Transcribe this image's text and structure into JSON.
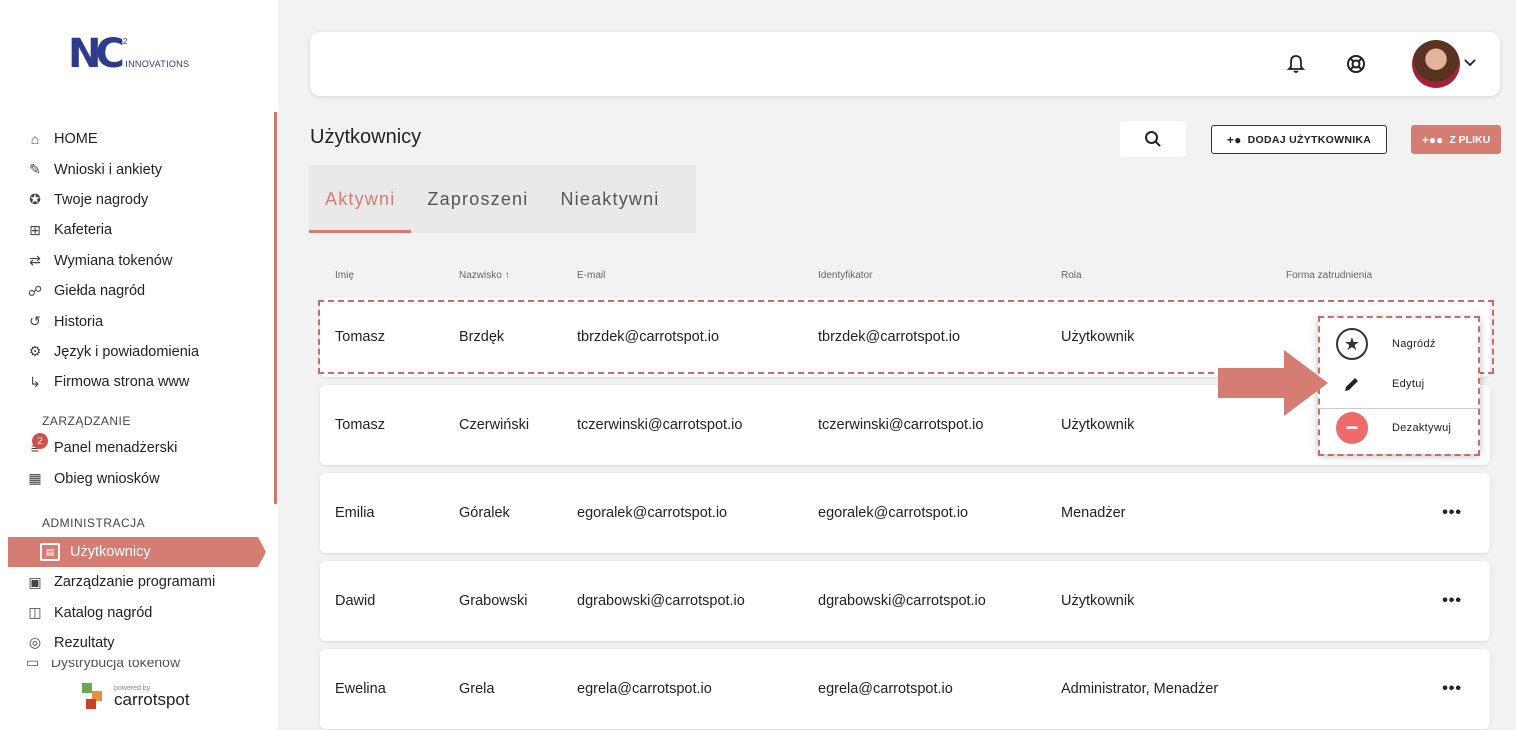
{
  "logo": {
    "mark": "NC",
    "sup": "2",
    "text": "INNOVATIONS"
  },
  "sidebar": {
    "items": [
      {
        "label": "HOME",
        "icon": "home-icon",
        "glyph": "⌂"
      },
      {
        "label": "Wnioski i ankiety",
        "icon": "form-edit-icon",
        "glyph": "✎"
      },
      {
        "label": "Twoje nagrody",
        "icon": "medal-icon",
        "glyph": "✪"
      },
      {
        "label": "Kafeteria",
        "icon": "store-icon",
        "glyph": "⊞"
      },
      {
        "label": "Wymiana tokenów",
        "icon": "ticket-icon",
        "glyph": "⇄"
      },
      {
        "label": "Giełda nagród",
        "icon": "handshake-icon",
        "glyph": "☍"
      },
      {
        "label": "Historia",
        "icon": "history-icon",
        "glyph": "↺"
      },
      {
        "label": "Język i powiadomienia",
        "icon": "gear-icon",
        "glyph": "⚙"
      },
      {
        "label": "Firmowa strona www",
        "icon": "subdirectory-arrow-icon",
        "glyph": "↳"
      }
    ],
    "section_management": "ZARZĄDZANIE",
    "management_items": [
      {
        "label": "Panel menadżerski",
        "icon": "people-list-icon",
        "glyph": "≡"
      },
      {
        "label": "Obieg wniosków",
        "icon": "workflow-icon",
        "glyph": "▦",
        "badge": "2"
      }
    ],
    "section_admin": "ADMINISTRACJA",
    "active_item": {
      "label": "Użytkownicy",
      "icon": "id-card-icon"
    },
    "admin_items": [
      {
        "label": "Zarządzanie programami",
        "icon": "program-folder-icon",
        "glyph": "▣"
      },
      {
        "label": "Katalog nagród",
        "icon": "shopping-bag-icon",
        "glyph": "◫"
      },
      {
        "label": "Rezultaty",
        "icon": "target-icon",
        "glyph": "◎"
      }
    ],
    "cutoff_item": "Dystrybucja tokenów",
    "powered_by": "powered by",
    "brand": "carrotspot"
  },
  "header": {
    "page_title": "Użytkownicy",
    "add_user_label": "DODAJ UŻYTKOWNIKA",
    "from_file_label": "Z PLIKU"
  },
  "tabs": [
    {
      "label": "Aktywni",
      "active": true
    },
    {
      "label": "Zaproszeni",
      "active": false
    },
    {
      "label": "Nieaktywni",
      "active": false
    }
  ],
  "table": {
    "columns": [
      "Imię",
      "Nazwisko ↑",
      "E-mail",
      "Identyfikator",
      "Rola",
      "Forma zatrudnienia"
    ],
    "rows": [
      {
        "first": "Tomasz",
        "last": "Brzdęk",
        "email": "tbrzdek@carrotspot.io",
        "id": "tbrzdek@carrotspot.io",
        "role": "Użytkownik",
        "employment": ""
      },
      {
        "first": "Tomasz",
        "last": "Czerwiński",
        "email": "tczerwinski@carrotspot.io",
        "id": "tczerwinski@carrotspot.io",
        "role": "Użytkownik",
        "employment": ""
      },
      {
        "first": "Emilia",
        "last": "Góralek",
        "email": "egoralek@carrotspot.io",
        "id": "egoralek@carrotspot.io",
        "role": "Menadżer",
        "employment": ""
      },
      {
        "first": "Dawid",
        "last": "Grabowski",
        "email": "dgrabowski@carrotspot.io",
        "id": "dgrabowski@carrotspot.io",
        "role": "Użytkownik",
        "employment": ""
      },
      {
        "first": "Ewelina",
        "last": "Grela",
        "email": "egrela@carrotspot.io",
        "id": "egrela@carrotspot.io",
        "role": "Administrator, Menadżer",
        "employment": ""
      }
    ],
    "more_label": "•••"
  },
  "context_menu": {
    "items": [
      {
        "label": "Nagródź",
        "icon": "star-icon"
      },
      {
        "label": "Edytuj",
        "icon": "pencil-icon"
      },
      {
        "label": "Dezaktywuj",
        "icon": "minus-circle-icon"
      }
    ]
  },
  "colors": {
    "accent": "#d57c73",
    "danger": "#ef6b6b",
    "brand_blue": "#2e3a8c",
    "highlight_dash": "#c96d66"
  }
}
